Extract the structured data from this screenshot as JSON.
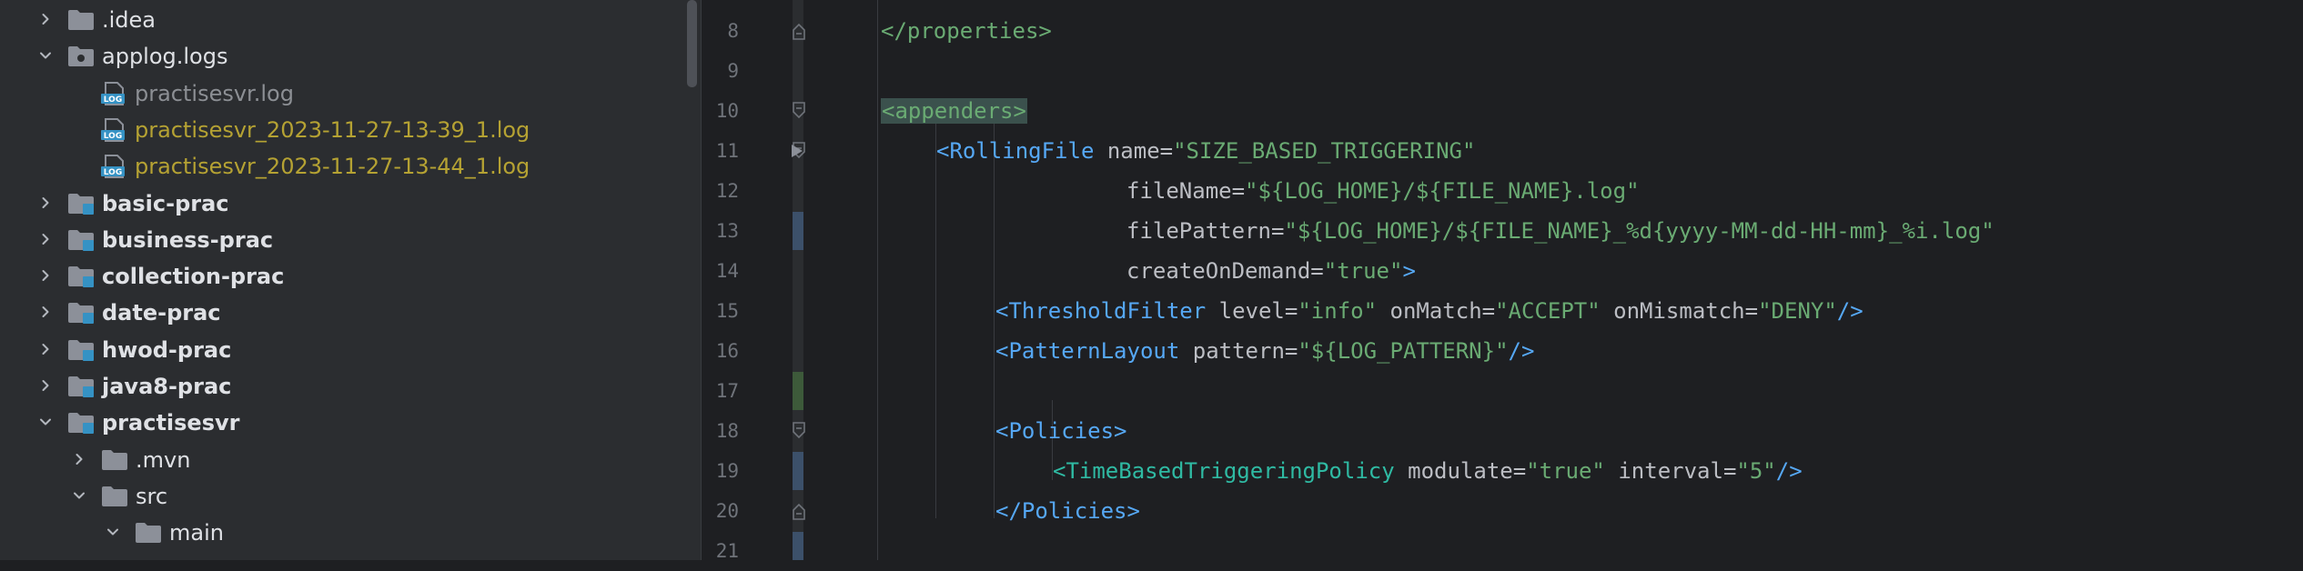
{
  "project_tree": {
    "items": [
      {
        "label": ".idea",
        "expanded": false,
        "style": "normal",
        "icon": "folder-icon"
      },
      {
        "label": "applog.logs",
        "expanded": true,
        "style": "normal",
        "icon": "folder-icon"
      },
      {
        "label": "practisesvr.log",
        "style": "grey",
        "icon": "log-file-icon"
      },
      {
        "label": "practisesvr_2023-11-27-13-39_1.log",
        "style": "yellow",
        "icon": "log-file-icon"
      },
      {
        "label": "practisesvr_2023-11-27-13-44_1.log",
        "style": "yellow",
        "icon": "log-file-icon"
      },
      {
        "label": "basic-prac",
        "expanded": false,
        "style": "bold",
        "icon": "module-folder-icon"
      },
      {
        "label": "business-prac",
        "expanded": false,
        "style": "bold",
        "icon": "module-folder-icon"
      },
      {
        "label": "collection-prac",
        "expanded": false,
        "style": "bold",
        "icon": "module-folder-icon"
      },
      {
        "label": "date-prac",
        "expanded": false,
        "style": "bold",
        "icon": "module-folder-icon"
      },
      {
        "label": "hwod-prac",
        "expanded": false,
        "style": "bold",
        "icon": "module-folder-icon"
      },
      {
        "label": "java8-prac",
        "expanded": false,
        "style": "bold",
        "icon": "module-folder-icon"
      },
      {
        "label": "practisesvr",
        "expanded": true,
        "style": "bold",
        "icon": "module-folder-icon"
      },
      {
        "label": ".mvn",
        "expanded": false,
        "style": "normal",
        "icon": "folder-icon"
      },
      {
        "label": "src",
        "expanded": true,
        "style": "normal",
        "icon": "folder-icon"
      },
      {
        "label": "main",
        "expanded": true,
        "style": "normal",
        "icon": "folder-icon"
      }
    ]
  },
  "editor": {
    "lines": [
      {
        "num": "8",
        "text": "</properties>"
      },
      {
        "num": "9",
        "text": ""
      },
      {
        "num": "10",
        "text": "<appenders>"
      },
      {
        "num": "11",
        "text": "<RollingFile name=\"SIZE_BASED_TRIGGERING\""
      },
      {
        "num": "12",
        "text": "fileName=\"${LOG_HOME}/${FILE_NAME}.log\""
      },
      {
        "num": "13",
        "text": "filePattern=\"${LOG_HOME}/${FILE_NAME}_%d{yyyy-MM-dd-HH-mm}_%i.log\""
      },
      {
        "num": "14",
        "text": "createOnDemand=\"true\">"
      },
      {
        "num": "15",
        "text": "<ThresholdFilter level=\"info\" onMatch=\"ACCEPT\" onMismatch=\"DENY\"/>"
      },
      {
        "num": "16",
        "text": "<PatternLayout pattern=\"${LOG_PATTERN}\"/>"
      },
      {
        "num": "17",
        "text": ""
      },
      {
        "num": "18",
        "text": "<Policies>"
      },
      {
        "num": "19",
        "text": "<TimeBasedTriggeringPolicy modulate=\"true\" interval=\"5\"/>"
      },
      {
        "num": "20",
        "text": "</Policies>"
      },
      {
        "num": "21",
        "text": ""
      }
    ]
  }
}
